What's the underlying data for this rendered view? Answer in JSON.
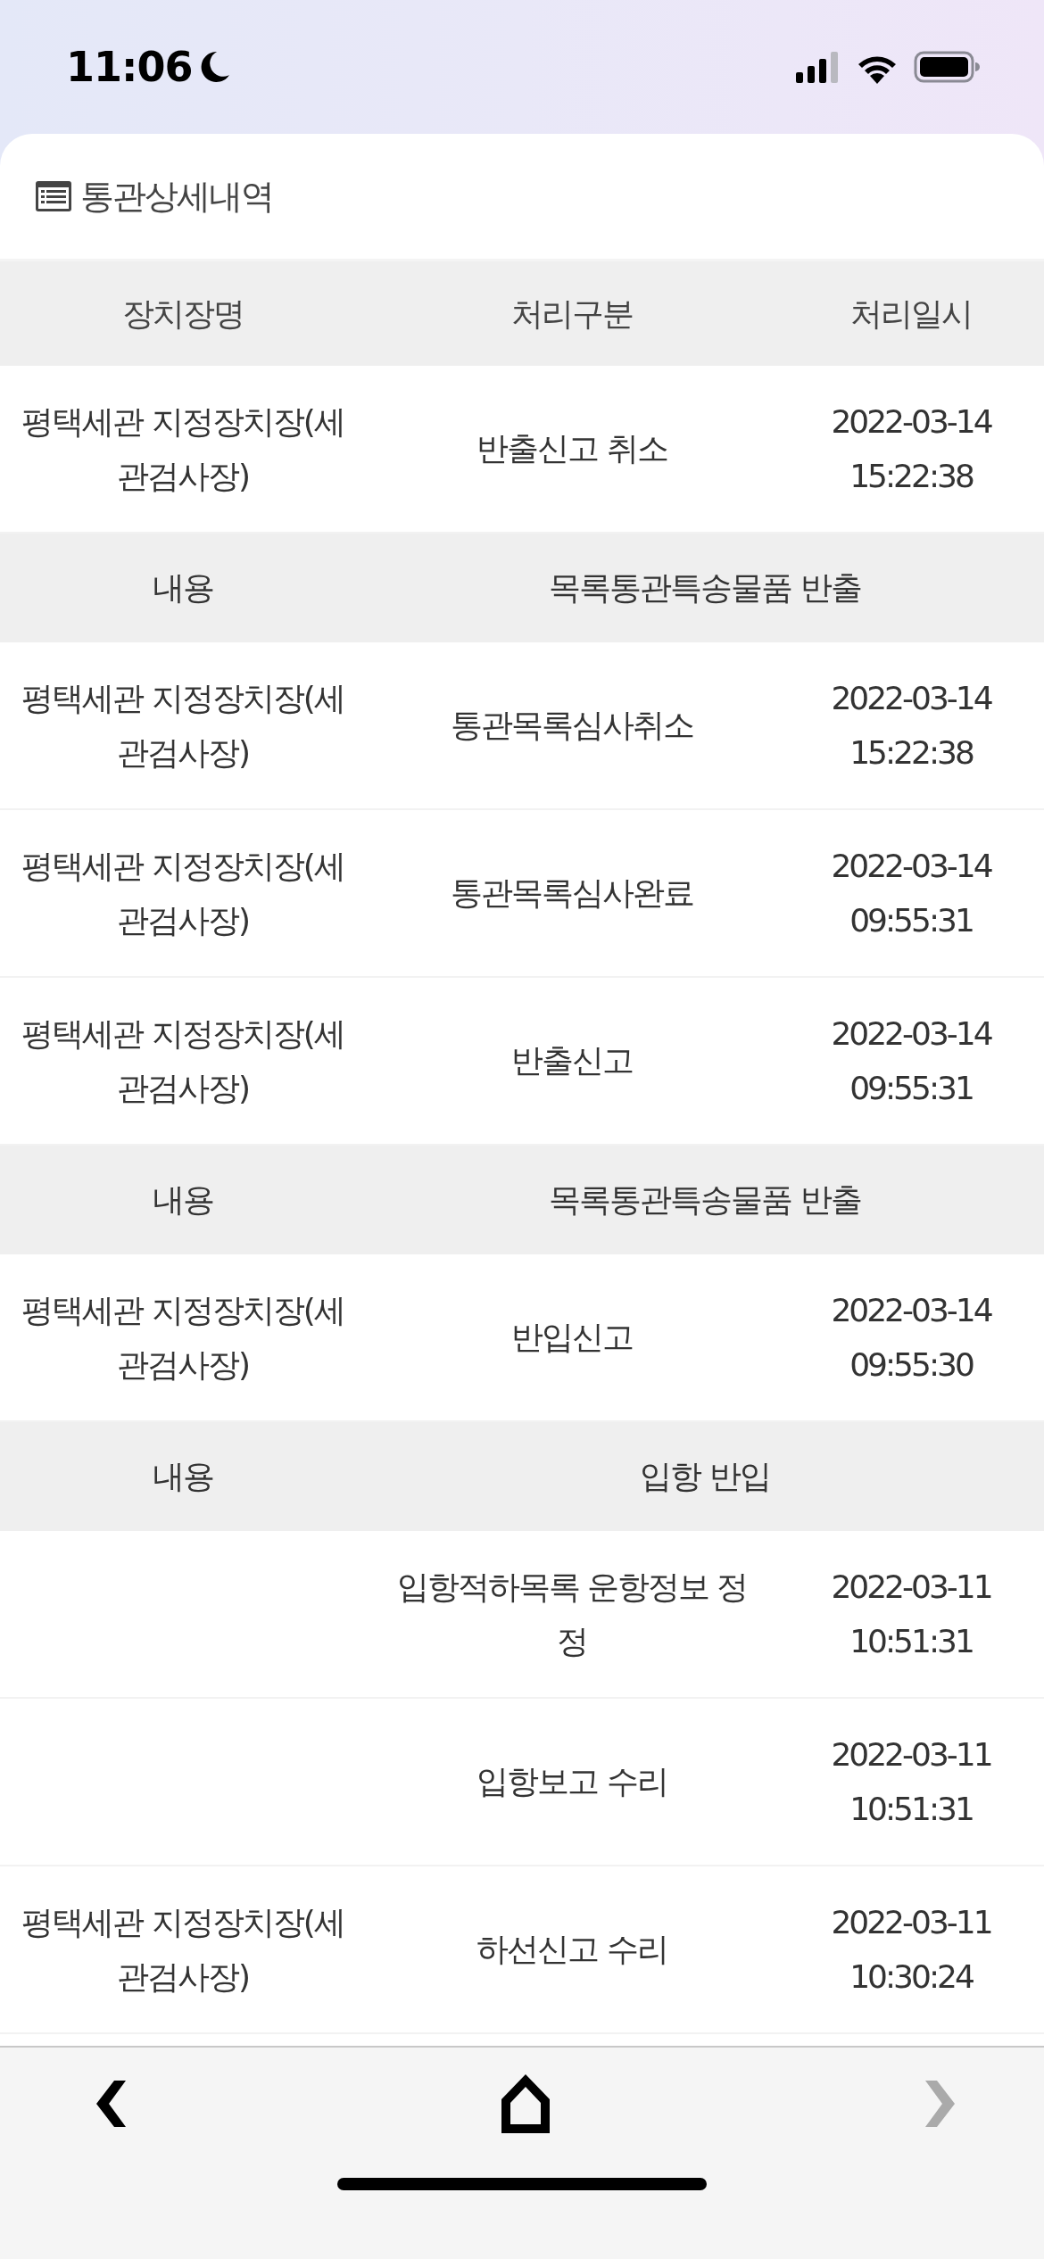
{
  "status_bar": {
    "time": "11:06"
  },
  "section": {
    "title": "통관상세내역"
  },
  "table": {
    "columns": [
      "장치장명",
      "처리구분",
      "처리일시"
    ],
    "rows": [
      {
        "kind": "record",
        "place": "평택세관 지정장치장(세관검사장)",
        "action": "반출신고 취소",
        "datetime": "2022-03-14 15:22:38"
      },
      {
        "kind": "detail",
        "label": "내용",
        "content": "목록통관특송물품 반출"
      },
      {
        "kind": "record",
        "place": "평택세관 지정장치장(세관검사장)",
        "action": "통관목록심사취소",
        "datetime": "2022-03-14 15:22:38"
      },
      {
        "kind": "record",
        "place": "평택세관 지정장치장(세관검사장)",
        "action": "통관목록심사완료",
        "datetime": "2022-03-14 09:55:31"
      },
      {
        "kind": "record",
        "place": "평택세관 지정장치장(세관검사장)",
        "action": "반출신고",
        "datetime": "2022-03-14 09:55:31"
      },
      {
        "kind": "detail",
        "label": "내용",
        "content": "목록통관특송물품 반출"
      },
      {
        "kind": "record",
        "place": "평택세관 지정장치장(세관검사장)",
        "action": "반입신고",
        "datetime": "2022-03-14 09:55:30"
      },
      {
        "kind": "detail",
        "label": "내용",
        "content": "입항 반입"
      },
      {
        "kind": "record",
        "action": "입항적하목록 운항정보 정정",
        "datetime": "2022-03-11 10:51:31"
      },
      {
        "kind": "record",
        "action": "입항보고 수리",
        "datetime": "2022-03-11 10:51:31"
      },
      {
        "kind": "record",
        "place": "평택세관 지정장치장(세관검사장)",
        "action": "하선신고 수리",
        "datetime": "2022-03-11 10:30:24"
      }
    ]
  },
  "nav": {
    "back": {
      "disabled": false
    },
    "forward": {
      "disabled": true
    }
  }
}
